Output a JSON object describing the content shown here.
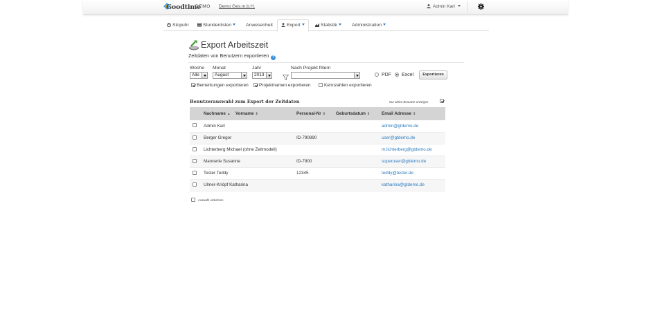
{
  "header": {
    "logo_text": "Goodtime",
    "demo_label": "DEMO",
    "company": "Demo Ges.m.b.H.",
    "user": "Admin Karl",
    "user_icon": "person-icon",
    "settings_icon": "gear-icon"
  },
  "nav": {
    "tabs": [
      {
        "label": "Stopuhr",
        "icon": "stopwatch-icon"
      },
      {
        "label": "Stundenlisten",
        "icon": "list-icon",
        "dropdown": true
      },
      {
        "label": "Anwesenheit"
      },
      {
        "label": "Export",
        "icon": "export-icon",
        "dropdown": true,
        "active": true
      },
      {
        "label": "Statistik",
        "icon": "chart-icon",
        "dropdown": true
      },
      {
        "label": "Administration",
        "dropdown": true
      }
    ]
  },
  "page": {
    "title": "Export Arbeitszeit",
    "subtitle": "Zeitdaten von Benutzern exportieren",
    "help_symbol": "?"
  },
  "filters": {
    "week_label": "Woche",
    "week_value": "Alle",
    "month_label": "Monat",
    "month_value": "August",
    "year_label": "Jahr",
    "year_value": "2013",
    "project_label": "Nach Projekt filtern",
    "project_value": "",
    "format_pdf": "PDF",
    "format_excel": "Excel",
    "selected_format": "Excel",
    "export_button": "Exportieren"
  },
  "options": [
    {
      "label": "Bemerkungen exportieren",
      "checked": true
    },
    {
      "label": "Projektnamen exportieren",
      "checked": true
    },
    {
      "label": "Kennzahlen exportieren",
      "checked": false
    }
  ],
  "users_section": {
    "title": "Benutzerauswahl zum Export der Zeitdaten",
    "active_only_label": "Nur aktive Benutzer anzeigen",
    "active_only_checked": true,
    "columns": [
      "Nachname",
      "Vorname",
      "Personal-Nr",
      "Geburtsdatum",
      "Email Adresse"
    ],
    "sort_column": "Nachname",
    "rows": [
      {
        "name": "Admin Karl",
        "personal_nr": "",
        "birthdate": "",
        "email": "admin@gtdemo.de"
      },
      {
        "name": "Berger Gregor",
        "personal_nr": "ID-790890",
        "birthdate": "",
        "email": "user@gtdemo.de"
      },
      {
        "name": "Lichterberg Michael (ohne Zeitmodell)",
        "personal_nr": "",
        "birthdate": "",
        "email": "m.lichterberg@gtdemo.de"
      },
      {
        "name": "Mannerle Susanne",
        "personal_nr": "ID-7900",
        "birthdate": "",
        "email": "superuser@gtdemo.de"
      },
      {
        "name": "Tester Teddy",
        "personal_nr": "12345",
        "birthdate": "",
        "email": "teddy@tester.de"
      },
      {
        "name": "Ulmer-Knöpf Katharina",
        "personal_nr": "",
        "birthdate": "",
        "email": "katharina@gtdemo.de"
      }
    ],
    "invert_label": "Auswahl umkehren"
  }
}
